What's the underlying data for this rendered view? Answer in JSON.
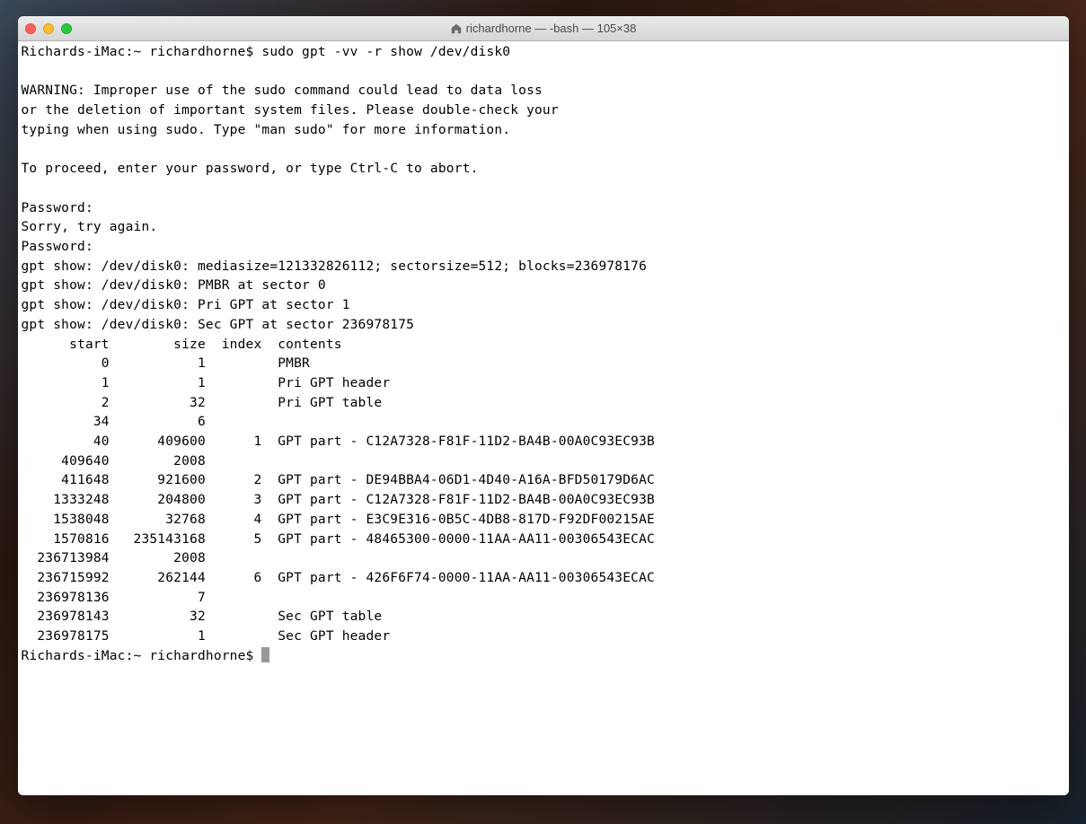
{
  "window": {
    "title": "richardhorne — -bash — 105×38"
  },
  "terminal": {
    "prompt1": "Richards-iMac:~ richardhorne$ ",
    "command": "sudo gpt -vv -r show /dev/disk0",
    "warning_lines": [
      "WARNING: Improper use of the sudo command could lead to data loss",
      "or the deletion of important system files. Please double-check your",
      "typing when using sudo. Type \"man sudo\" for more information."
    ],
    "proceed_line": "To proceed, enter your password, or type Ctrl-C to abort.",
    "password_label": "Password:",
    "sorry_line": "Sorry, try again.",
    "gpt_info_lines": [
      "gpt show: /dev/disk0: mediasize=121332826112; sectorsize=512; blocks=236978176",
      "gpt show: /dev/disk0: PMBR at sector 0",
      "gpt show: /dev/disk0: Pri GPT at sector 1",
      "gpt show: /dev/disk0: Sec GPT at sector 236978175"
    ],
    "table_header": {
      "start": "start",
      "size": "size",
      "index": "index",
      "contents": "contents"
    },
    "table_rows": [
      {
        "start": "0",
        "size": "1",
        "index": "",
        "contents": "PMBR"
      },
      {
        "start": "1",
        "size": "1",
        "index": "",
        "contents": "Pri GPT header"
      },
      {
        "start": "2",
        "size": "32",
        "index": "",
        "contents": "Pri GPT table"
      },
      {
        "start": "34",
        "size": "6",
        "index": "",
        "contents": ""
      },
      {
        "start": "40",
        "size": "409600",
        "index": "1",
        "contents": "GPT part - C12A7328-F81F-11D2-BA4B-00A0C93EC93B"
      },
      {
        "start": "409640",
        "size": "2008",
        "index": "",
        "contents": ""
      },
      {
        "start": "411648",
        "size": "921600",
        "index": "2",
        "contents": "GPT part - DE94BBA4-06D1-4D40-A16A-BFD50179D6AC"
      },
      {
        "start": "1333248",
        "size": "204800",
        "index": "3",
        "contents": "GPT part - C12A7328-F81F-11D2-BA4B-00A0C93EC93B"
      },
      {
        "start": "1538048",
        "size": "32768",
        "index": "4",
        "contents": "GPT part - E3C9E316-0B5C-4DB8-817D-F92DF00215AE"
      },
      {
        "start": "1570816",
        "size": "235143168",
        "index": "5",
        "contents": "GPT part - 48465300-0000-11AA-AA11-00306543ECAC"
      },
      {
        "start": "236713984",
        "size": "2008",
        "index": "",
        "contents": ""
      },
      {
        "start": "236715992",
        "size": "262144",
        "index": "6",
        "contents": "GPT part - 426F6F74-0000-11AA-AA11-00306543ECAC"
      },
      {
        "start": "236978136",
        "size": "7",
        "index": "",
        "contents": ""
      },
      {
        "start": "236978143",
        "size": "32",
        "index": "",
        "contents": "Sec GPT table"
      },
      {
        "start": "236978175",
        "size": "1",
        "index": "",
        "contents": "Sec GPT header"
      }
    ],
    "prompt2": "Richards-iMac:~ richardhorne$ "
  }
}
